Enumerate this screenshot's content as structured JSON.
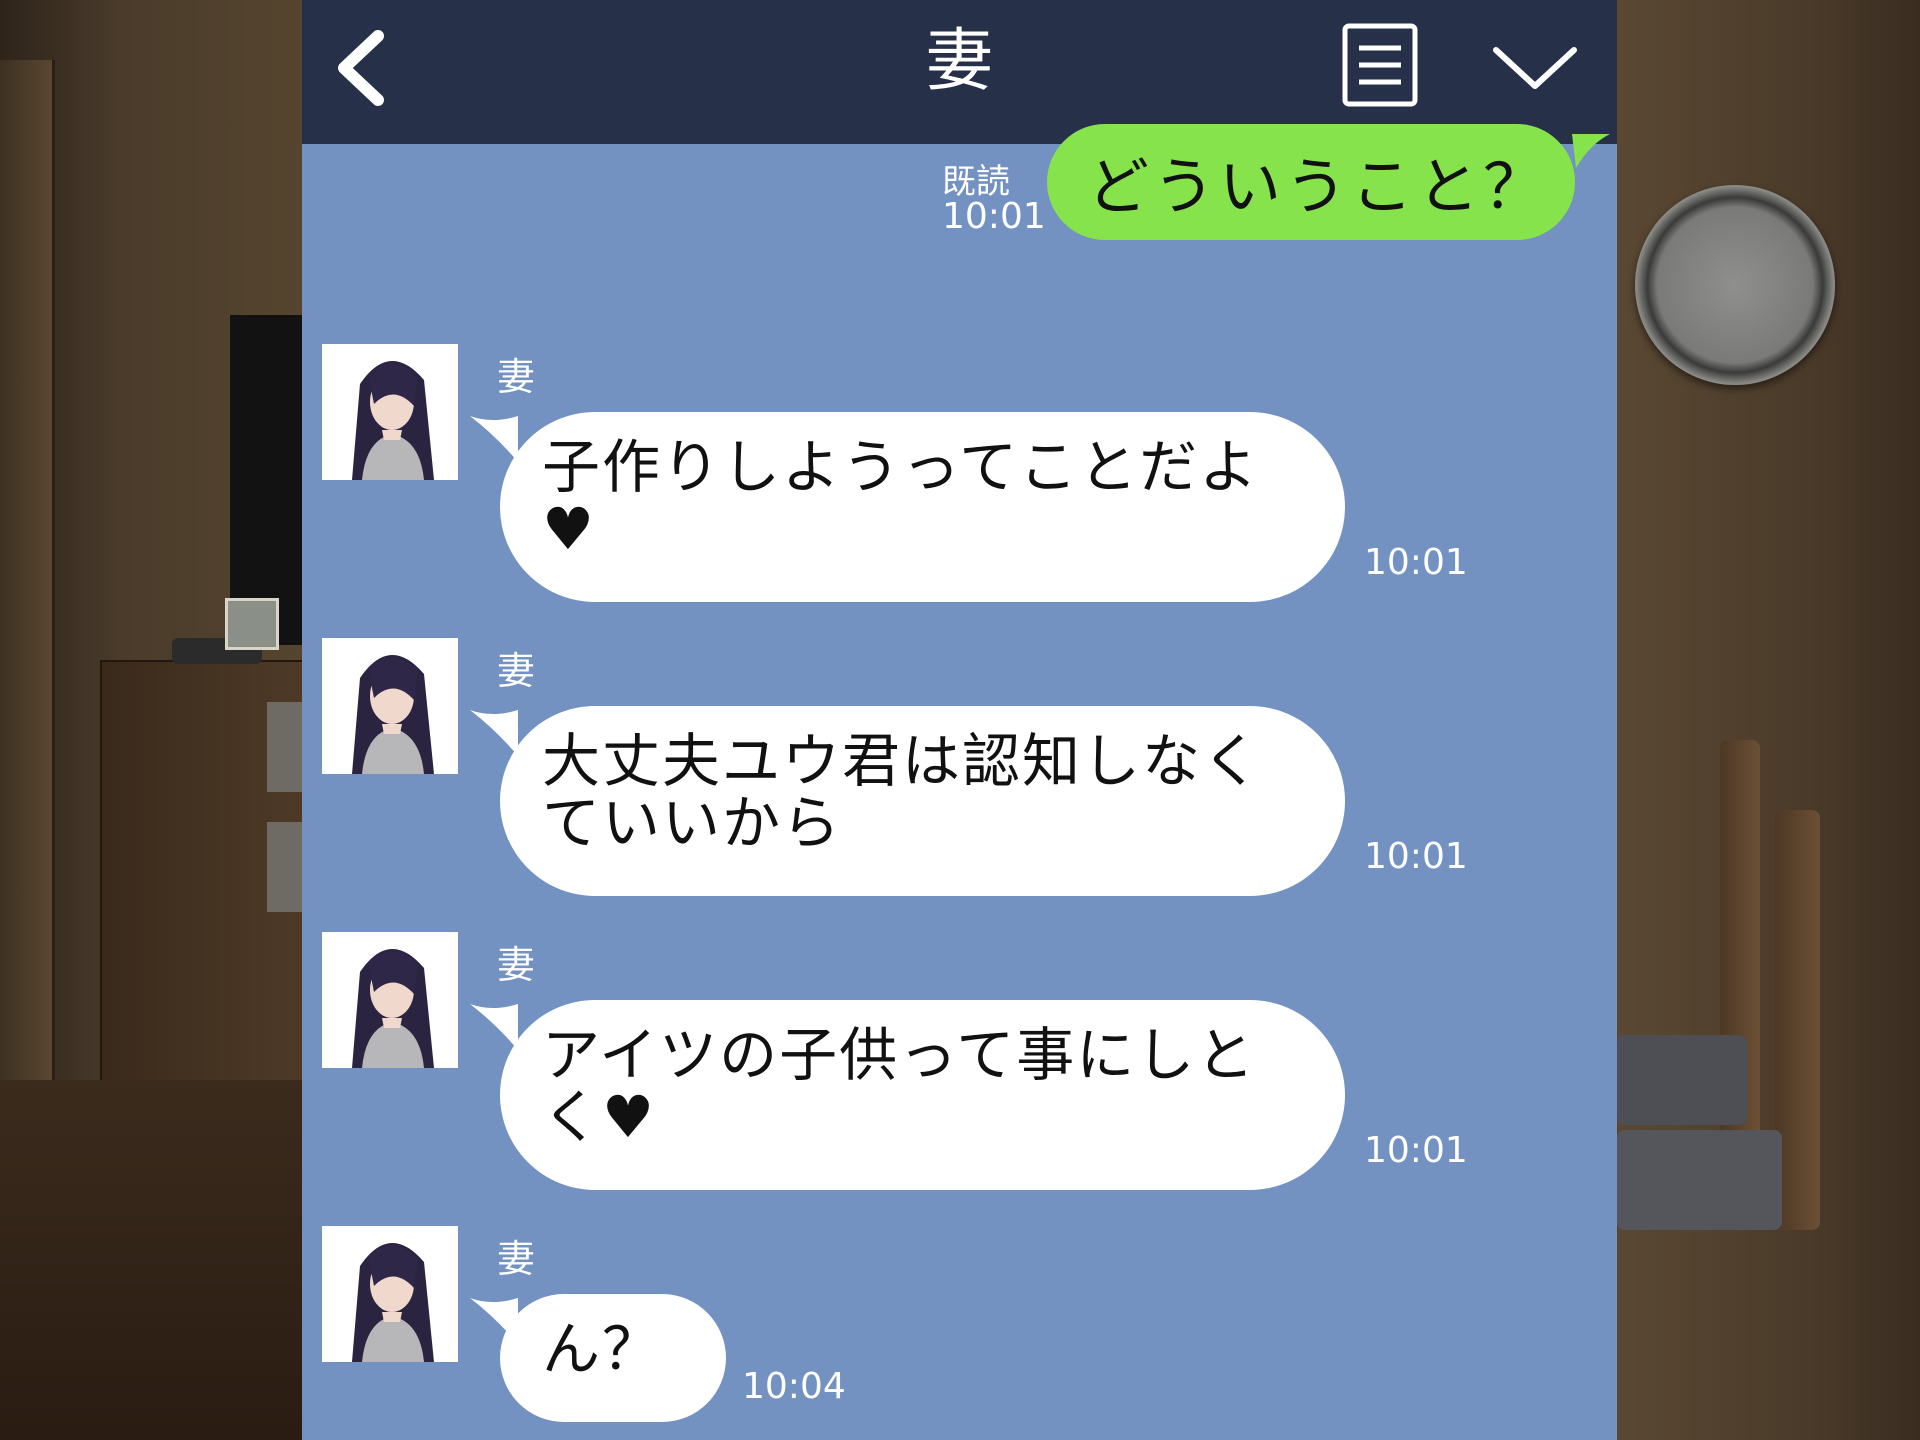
{
  "header": {
    "title": "妻"
  },
  "outgoing_message": {
    "text": "どういうこと？",
    "read_label": "既読",
    "time": "10:01",
    "bubble_color": "#86e34c"
  },
  "incoming_messages": [
    {
      "sender": "妻",
      "text": "子作りしようってことだよ\n♥",
      "time": "10:01"
    },
    {
      "sender": "妻",
      "text": "大丈夫ユウ君は認知しなく\nていいから",
      "time": "10:01"
    },
    {
      "sender": "妻",
      "text": "アイツの子供って事にしと\nく♥",
      "time": "10:01"
    },
    {
      "sender": "妻",
      "text": "ん？",
      "time": "10:04"
    }
  ],
  "colors": {
    "header_bg": "#263149",
    "chat_bg": "#7392c2",
    "incoming_bubble": "#ffffff"
  },
  "icons": {
    "back": "chevron-left-icon",
    "menu": "menu-list-icon",
    "collapse": "chevron-down-icon"
  }
}
